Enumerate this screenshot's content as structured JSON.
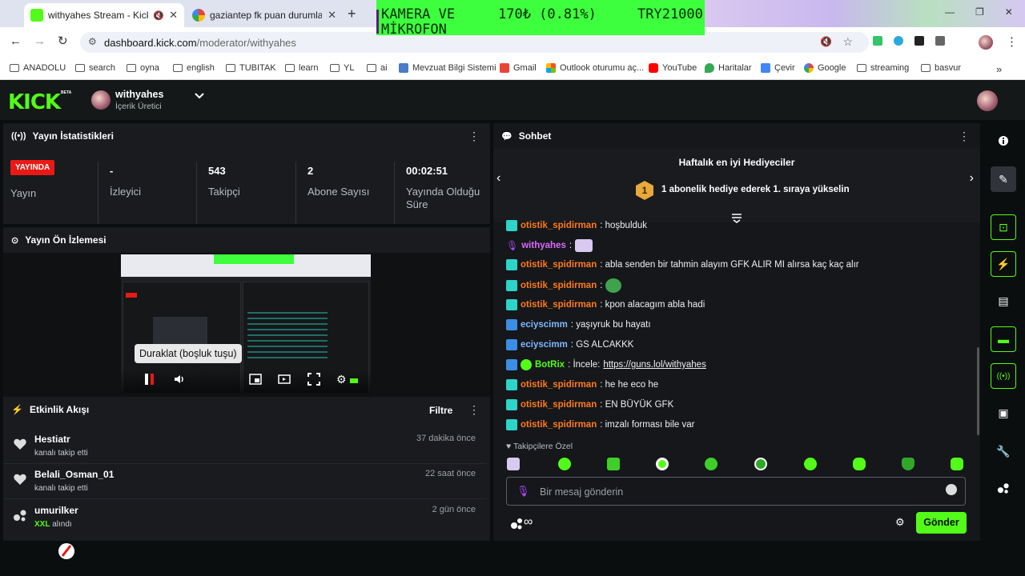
{
  "browser": {
    "tabs": [
      {
        "title": "withyahes Stream - Kick Da",
        "close": "✕"
      },
      {
        "title": "gaziantep fk puan durumları - G",
        "close": "✕"
      }
    ],
    "new_tab": "+",
    "url_host": "dashboard.kick.com",
    "url_path": "/moderator/withyahes",
    "overlay": {
      "line1_left": "KAMERA VE",
      "line1_mid": "170₺ (0.81%)",
      "line1_right": "TRY21000",
      "line2": "MİKROFON"
    },
    "bookmarks": [
      "ANADOLU",
      "search",
      "oyna",
      "english",
      "TUBITAK",
      "learn",
      "YL",
      "ai",
      "Mevzuat Bilgi Sistemi",
      "Gmail",
      "Outlook oturumu aç...",
      "YouTube",
      "Haritalar",
      "Çevir",
      "Google",
      "streaming",
      "basvur"
    ],
    "more": "»"
  },
  "header": {
    "logo": "KICK",
    "beta": "BETA",
    "username": "withyahes",
    "role": "İçerik Üretici",
    "chevron": "⌄"
  },
  "stats": {
    "title": "Yayın İstatistikleri",
    "live_badge": "YAYINDA",
    "items": [
      {
        "value": "",
        "label": "Yayın"
      },
      {
        "value": "-",
        "label": "İzleyici"
      },
      {
        "value": "543",
        "label": "Takipçi"
      },
      {
        "value": "2",
        "label": "Abone Sayısı"
      },
      {
        "value": "00:02:51",
        "label": "Yayında Olduğu Süre"
      }
    ]
  },
  "preview": {
    "title": "Yayın Ön İzlemesi",
    "tooltip": "Duraklat (boşluk tuşu)"
  },
  "activity": {
    "title": "Etkinlik Akışı",
    "filter": "Filtre",
    "events": [
      {
        "name": "Hestiatr",
        "sub": "kanalı takip etti",
        "time": "37 dakika önce",
        "icon": "heart-icon"
      },
      {
        "name": "Belali_Osman_01",
        "sub": "kanalı takip etti",
        "time": "22 saat önce",
        "icon": "heart-icon"
      },
      {
        "name": "umurilker",
        "sub_bold": "XXL",
        "sub": " alındı",
        "time": "2 gün önce",
        "icon": "subgift-icon"
      }
    ]
  },
  "chat": {
    "title": "Sohbet",
    "gifters_title": "Haftalık en iyi Hediyeciler",
    "gifters_text": "1 abonelik hediye ederek 1. sıraya yükselin",
    "gifters_rank": "1",
    "messages": [
      {
        "user": "otistik_spidirman",
        "text": ": hoşbulduk",
        "color": "#ff7a1a",
        "badge": "#2dd4c8"
      },
      {
        "user": "withyahes",
        "text": ":",
        "color": "#d86bff",
        "badge": "#b04cff",
        "emote": true
      },
      {
        "user": "otistik_spidirman",
        "text": ": abla senden bir tahmin alayım GFK ALIR MI alırsa kaç kaç alır",
        "color": "#ff7a1a",
        "badge": "#2dd4c8"
      },
      {
        "user": "otistik_spidirman",
        "text": ":",
        "color": "#ff7a1a",
        "badge": "#2dd4c8",
        "emote": true
      },
      {
        "user": "otistik_spidirman",
        "text": ": kpon alacagım abla hadi",
        "color": "#ff7a1a",
        "badge": "#2dd4c8"
      },
      {
        "user": "eciyscimm",
        "text": ": yaşıyruk bu hayatı",
        "color": "#7db7ff",
        "badge": "#3a8ee6"
      },
      {
        "user": "eciyscimm",
        "text": ": GS ALCAKKK",
        "color": "#7db7ff",
        "badge": "#3a8ee6"
      },
      {
        "user": "BotRix",
        "text": ": İncele: ",
        "link": "https://guns.lol/withyahes",
        "color": "#53fc18",
        "badge": "#3a8ee6"
      },
      {
        "user": "otistik_spidirman",
        "text": ": he he eco he",
        "color": "#ff7a1a",
        "badge": "#2dd4c8"
      },
      {
        "user": "otistik_spidirman",
        "text": ": EN BÜYÜK GFK",
        "color": "#ff7a1a",
        "badge": "#2dd4c8"
      },
      {
        "user": "otistik_spidirman",
        "text": ": imzalı forması bile var",
        "color": "#ff7a1a",
        "badge": "#2dd4c8"
      }
    ],
    "followers_only": "Takipçilere Özel",
    "input_placeholder": "Bir mesaj gönderin",
    "send": "Gönder"
  },
  "colors": {
    "accent": "#53fc18",
    "live": "#e91916",
    "panel": "#191b1f",
    "bg": "#0b0e0f"
  }
}
